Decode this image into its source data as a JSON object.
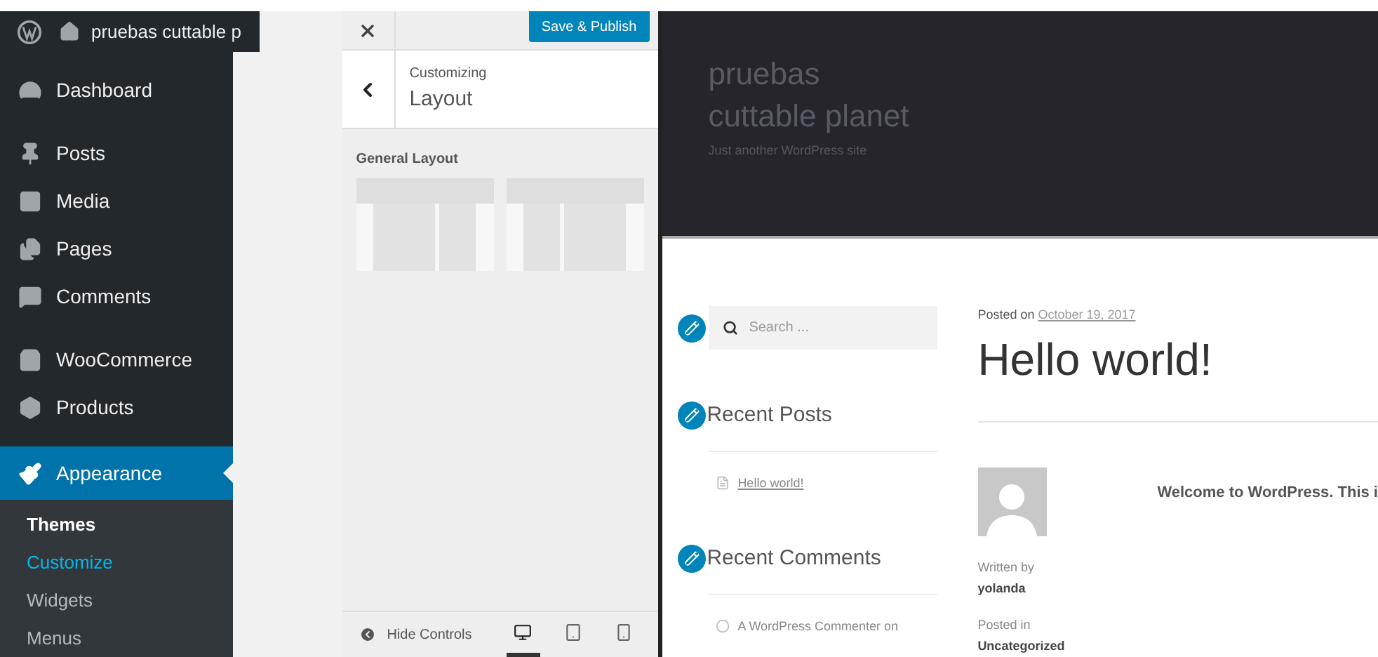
{
  "admin_bar": {
    "site_name": "pruebas cuttable p"
  },
  "sidebar": {
    "items": [
      {
        "label": "Dashboard",
        "kind": "gauge",
        "selected": false
      },
      {
        "label": "Posts",
        "kind": "pin",
        "selected": false
      },
      {
        "label": "Media",
        "kind": "media",
        "selected": false
      },
      {
        "label": "Pages",
        "kind": "pages",
        "selected": false
      },
      {
        "label": "Comments",
        "kind": "comment",
        "selected": false
      },
      {
        "label": "WooCommerce",
        "kind": "woo",
        "selected": false
      },
      {
        "label": "Products",
        "kind": "box",
        "selected": false
      },
      {
        "label": "Appearance",
        "kind": "brush",
        "selected": true
      }
    ],
    "submenu": [
      {
        "label": "Themes",
        "kind": "parent",
        "selected": false
      },
      {
        "label": "Customize",
        "kind": "link",
        "selected": true
      },
      {
        "label": "Widgets",
        "kind": "link",
        "selected": false
      },
      {
        "label": "Menus",
        "kind": "link",
        "selected": false
      }
    ]
  },
  "customizer": {
    "save_button": "Save & Publish",
    "breadcrumb": "Customizing",
    "title": "Layout",
    "section_title": "General Layout",
    "layouts": [
      {
        "kind": "content-sidebar"
      },
      {
        "kind": "sidebar-content"
      }
    ],
    "footer": {
      "hide_controls": "Hide Controls",
      "devices": [
        {
          "kind": "desktop",
          "selected": true
        },
        {
          "kind": "tablet",
          "selected": false
        },
        {
          "kind": "mobile",
          "selected": false
        }
      ]
    }
  },
  "preview": {
    "site_title": "pruebas cuttable planet",
    "tagline": "Just another WordPress site",
    "search": {
      "placeholder": "Search ..."
    },
    "widgets": [
      {
        "title": "Recent Posts",
        "kind": "posts",
        "items": [
          "Hello world!"
        ]
      },
      {
        "title": "Recent Comments",
        "kind": "comments",
        "items": [
          "A WordPress Commenter on"
        ]
      }
    ],
    "post": {
      "posted_on": "Posted on",
      "date": "October 19, 2017",
      "title": "Hello world!",
      "author_label": "Written by",
      "author": "yolanda",
      "category_label": "Posted in",
      "category": "Uncategorized",
      "excerpt": "Welcome to WordPress. This i"
    }
  }
}
